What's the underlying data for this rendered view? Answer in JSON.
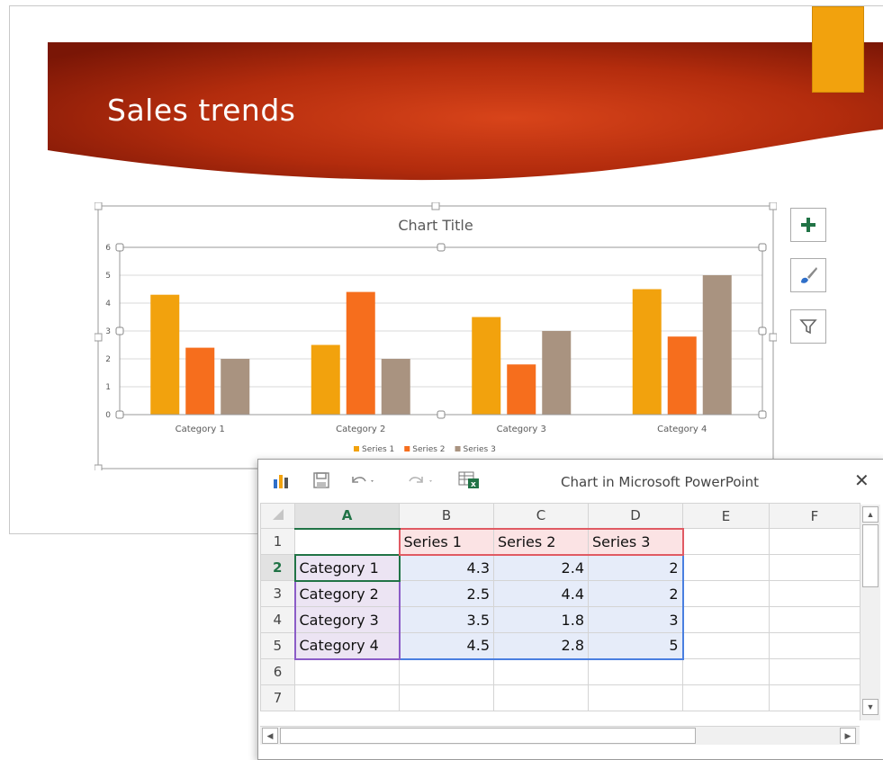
{
  "slide": {
    "title": "Sales trends",
    "colors": {
      "banner_dark": "#7a1606",
      "banner_light": "#d8441a",
      "accent": "#f2a20d"
    }
  },
  "chart_data": {
    "type": "bar",
    "title": "Chart Title",
    "categories": [
      "Category 1",
      "Category 2",
      "Category 3",
      "Category 4"
    ],
    "series": [
      {
        "name": "Series 1",
        "values": [
          4.3,
          2.5,
          3.5,
          4.5
        ],
        "color": "#f2a20d"
      },
      {
        "name": "Series 2",
        "values": [
          2.4,
          4.4,
          1.8,
          2.8
        ],
        "color": "#f66e1d"
      },
      {
        "name": "Series 3",
        "values": [
          2,
          2,
          3,
          5
        ],
        "color": "#a99380"
      }
    ],
    "yticks": [
      "0",
      "1",
      "2",
      "3",
      "4",
      "5",
      "6"
    ],
    "ylim": [
      0,
      6
    ],
    "grid": true,
    "legend_position": "bottom"
  },
  "chart_tools": {
    "add_icon": "plus-icon",
    "style_icon": "paintbrush-icon",
    "filter_icon": "funnel-icon"
  },
  "excel": {
    "title": "Chart in Microsoft PowerPoint",
    "close": "✕",
    "columns": [
      "A",
      "B",
      "C",
      "D",
      "E",
      "F"
    ],
    "rows": [
      {
        "num": "1",
        "cells": [
          "",
          "Series 1",
          "Series 2",
          "Series 3",
          "",
          ""
        ]
      },
      {
        "num": "2",
        "cells": [
          "Category 1",
          "4.3",
          "2.4",
          "2",
          "",
          ""
        ]
      },
      {
        "num": "3",
        "cells": [
          "Category 2",
          "2.5",
          "4.4",
          "2",
          "",
          ""
        ]
      },
      {
        "num": "4",
        "cells": [
          "Category 3",
          "3.5",
          "1.8",
          "3",
          "",
          ""
        ]
      },
      {
        "num": "5",
        "cells": [
          "Category 4",
          "4.5",
          "2.8",
          "5",
          "",
          ""
        ]
      },
      {
        "num": "6",
        "cells": [
          "",
          "",
          "",
          "",
          "",
          ""
        ]
      },
      {
        "num": "7",
        "cells": [
          "",
          "",
          "",
          "",
          "",
          ""
        ]
      }
    ],
    "selected_cell": "A2"
  }
}
